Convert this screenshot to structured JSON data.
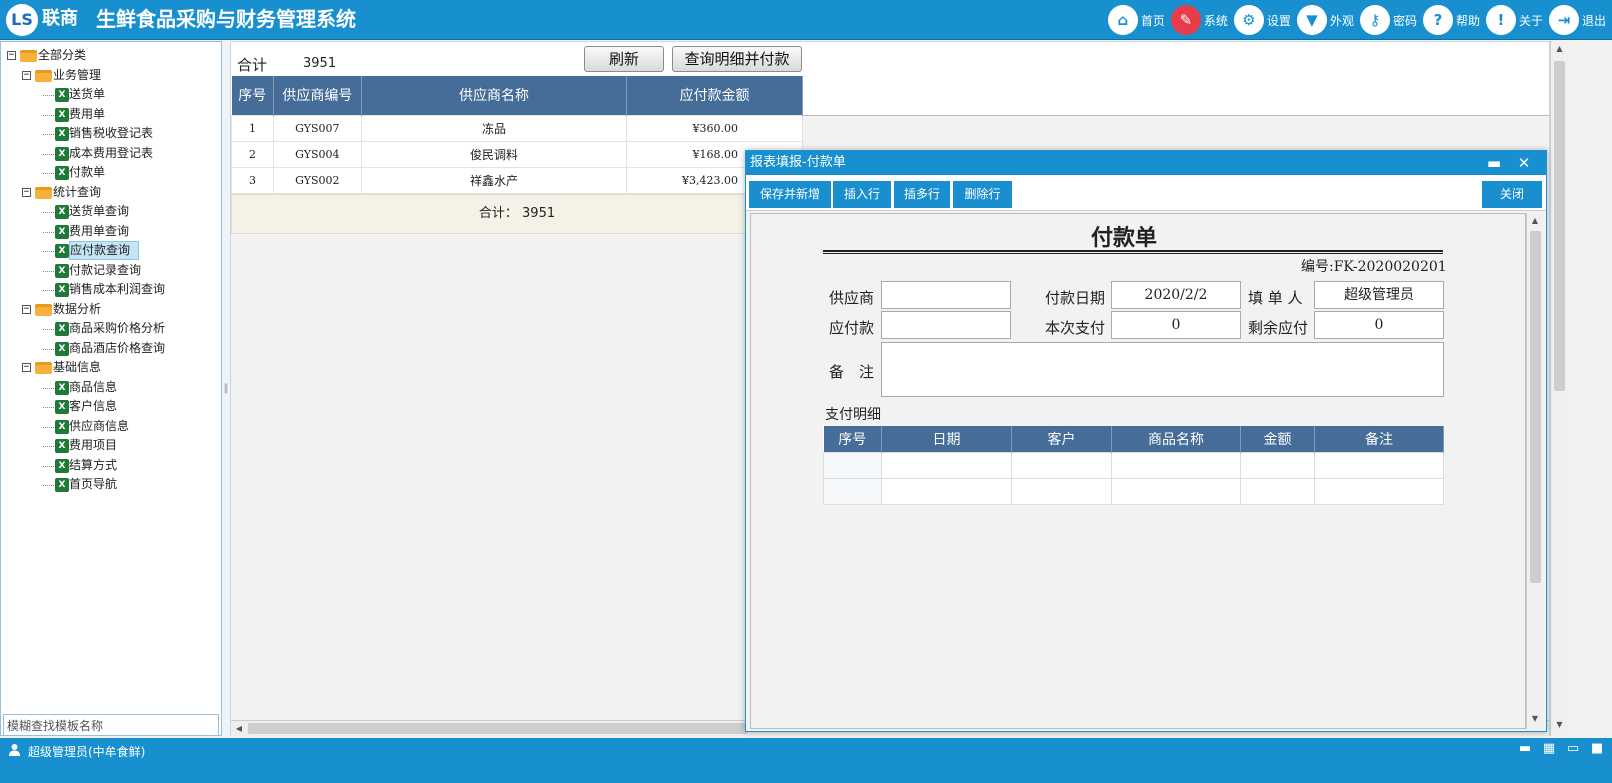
{
  "app": {
    "logo_mark": "LS",
    "logo_text": "联商",
    "title": "生鲜食品采购与财务管理系统"
  },
  "topnav": [
    {
      "label": "首页",
      "glyph": "⌂",
      "icon": "home-icon"
    },
    {
      "label": "系统",
      "glyph": "✎",
      "icon": "system-icon"
    },
    {
      "label": "设置",
      "glyph": "⚙",
      "icon": "gear-icon"
    },
    {
      "label": "外观",
      "glyph": "▼",
      "icon": "tshirt-icon"
    },
    {
      "label": "密码",
      "glyph": "⚷",
      "icon": "key-icon"
    },
    {
      "label": "帮助",
      "glyph": "?",
      "icon": "help-icon"
    },
    {
      "label": "关于",
      "glyph": "!",
      "icon": "about-icon"
    },
    {
      "label": "退出",
      "glyph": "⇥",
      "icon": "exit-icon"
    }
  ],
  "tree": [
    {
      "label": "全部分类",
      "type": "folder",
      "level": 0
    },
    {
      "label": "业务管理",
      "type": "folder",
      "level": 1
    },
    {
      "label": "送货单",
      "type": "file",
      "level": 2
    },
    {
      "label": "费用单",
      "type": "file",
      "level": 2
    },
    {
      "label": "销售税收登记表",
      "type": "file",
      "level": 2
    },
    {
      "label": "成本费用登记表",
      "type": "file",
      "level": 2
    },
    {
      "label": "付款单",
      "type": "file",
      "level": 2
    },
    {
      "label": "统计查询",
      "type": "folder",
      "level": 1
    },
    {
      "label": "送货单查询",
      "type": "file",
      "level": 2
    },
    {
      "label": "费用单查询",
      "type": "file",
      "level": 2
    },
    {
      "label": "应付款查询",
      "type": "file",
      "level": 2,
      "selected": true
    },
    {
      "label": "付款记录查询",
      "type": "file",
      "level": 2
    },
    {
      "label": "销售成本利润查询",
      "type": "file",
      "level": 2
    },
    {
      "label": "数据分析",
      "type": "folder",
      "level": 1
    },
    {
      "label": "商品采购价格分析",
      "type": "file",
      "level": 2
    },
    {
      "label": "商品酒店价格查询",
      "type": "file",
      "level": 2
    },
    {
      "label": "基础信息",
      "type": "folder",
      "level": 1
    },
    {
      "label": "商品信息",
      "type": "file",
      "level": 2
    },
    {
      "label": "客户信息",
      "type": "file",
      "level": 2
    },
    {
      "label": "供应商信息",
      "type": "file",
      "level": 2
    },
    {
      "label": "费用项目",
      "type": "file",
      "level": 2
    },
    {
      "label": "结算方式",
      "type": "file",
      "level": 2
    },
    {
      "label": "首页导航",
      "type": "file",
      "level": 2
    }
  ],
  "sidebar": {
    "search_value": "模糊查找模板名称"
  },
  "main": {
    "total_label": "合计",
    "total_value": "3951",
    "refresh_label": "刷新",
    "query_pay_label": "查询明细并付款",
    "columns": [
      "序号",
      "供应商编号",
      "供应商名称",
      "应付款金额"
    ],
    "rows": [
      [
        "1",
        "GYS007",
        "冻品",
        "¥360.00"
      ],
      [
        "2",
        "GYS004",
        "俊民调料",
        "¥168.00"
      ],
      [
        "3",
        "GYS002",
        "祥鑫水产",
        "¥3,423.00"
      ]
    ],
    "footer_label": "合计：",
    "footer_value": "3951"
  },
  "dialog": {
    "title": "报表填报-付款单",
    "minimize": "▬",
    "close": "✕",
    "toolbar": {
      "save_new": "保存并新增",
      "insert_row": "插入行",
      "insert_rows": "插多行",
      "delete_row": "删除行",
      "close": "关闭"
    },
    "form": {
      "title": "付款单",
      "number": "编号:FK-2020020201",
      "supplier_label": "供应商",
      "supplier_value": "",
      "pay_date_label": "付款日期",
      "pay_date_value": "2020/2/2",
      "filler_label": "填 单 人",
      "filler_value": "超级管理员",
      "payable_label": "应付款",
      "payable_value": "",
      "this_pay_label": "本次支付",
      "this_pay_value": "0",
      "remain_label": "剩余应付",
      "remain_value": "0",
      "remark_label": "备　注",
      "remark_value": "",
      "detail_title": "支付明细",
      "detail_columns": [
        "序号",
        "日期",
        "客户",
        "商品名称",
        "金额",
        "备注"
      ]
    }
  },
  "status": {
    "user": "超级管理员(中牟食鲜)"
  }
}
